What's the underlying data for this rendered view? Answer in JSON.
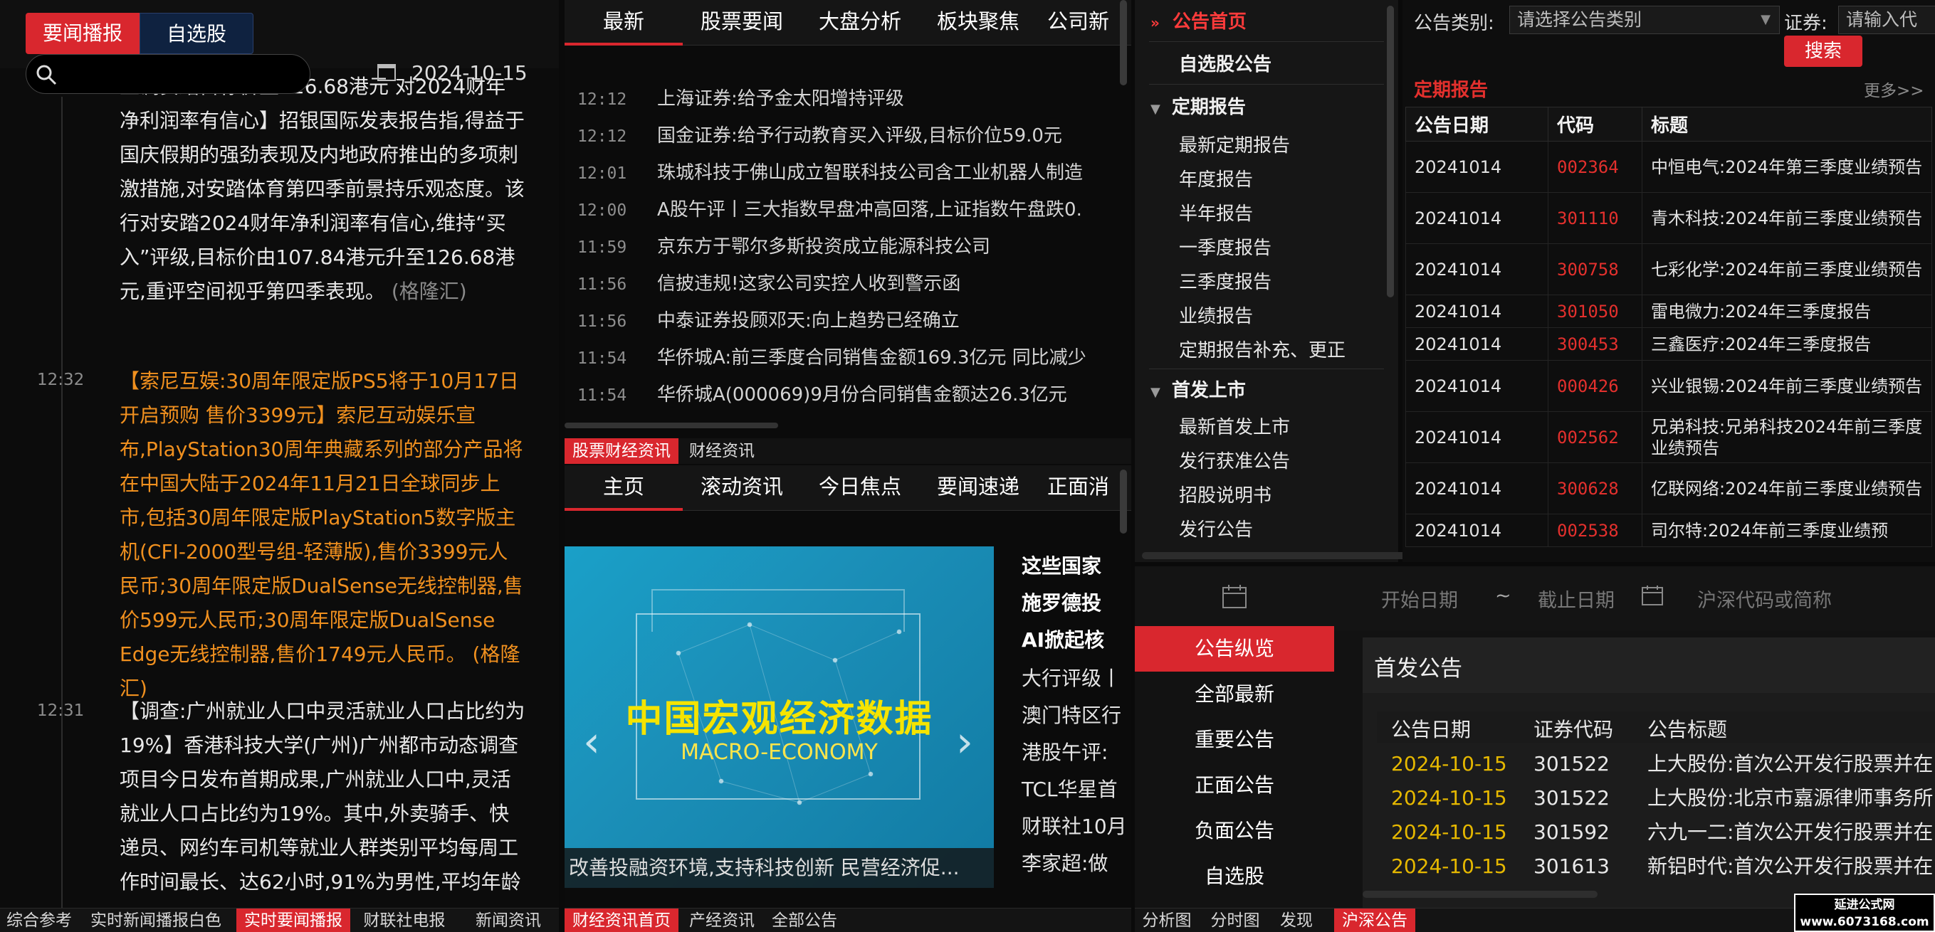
{
  "left": {
    "tabs": [
      "要闻播报",
      "自选股"
    ],
    "date": "2024-10-15",
    "items": [
      {
        "time": "",
        "highlight": false,
        "text": "上调安踏目标价至126.68港元 对2024财年净利润率有信心】招银国际发表报告指,得益于国庆假期的强劲表现及内地政府推出的多项刺激措施,对安踏体育第四季前景持乐观态度。该行对安踏2024财年净利润率有信心,维持“买入”评级,目标价由107.84港元升至126.68港元,重评空间视乎第四季表现。",
        "source": "(格隆汇)"
      },
      {
        "time": "12:32",
        "highlight": true,
        "text": "【索尼互娱:30周年限定版PS5将于10月17日开启预购 售价3399元】索尼互动娱乐宣布,PlayStation30周年典藏系列的部分产品将在中国大陆于2024年11月21日全球同步上市,包括30周年限定版PlayStation5数字版主机(CFI-2000型号组-轻薄版),售价3399元人民币;30周年限定版DualSense无线控制器,售价599元人民币;30周年限定版DualSense Edge无线控制器,售价1749元人民币。",
        "source": "(格隆汇)"
      },
      {
        "time": "12:31",
        "highlight": false,
        "text": "【调查:广州就业人口中灵活就业人口占比约为19%】香港科技大学(广州)广州都市动态调查项目今日发布首期成果,广州就业人口中,灵活就业人口占比约为19%。其中,外卖骑手、快递员、网约车司机等就业人群类别平均每周工作时间最长、达62小时,91%为男性,平均年龄",
        "source": ""
      }
    ],
    "bottom_tabs": [
      "综合参考",
      "实时新闻播报白色",
      "实时要闻播报",
      "财联社电报",
      "新闻资讯"
    ]
  },
  "mid": {
    "top_nav": [
      "最新",
      "股票要闻",
      "大盘分析",
      "板块聚焦",
      "公司新"
    ],
    "flash": [
      {
        "time": "12:12",
        "text": "上海证券:给予金太阳增持评级"
      },
      {
        "time": "12:12",
        "text": "国金证券:给予行动教育买入评级,目标价位59.0元"
      },
      {
        "time": "12:01",
        "text": "珠城科技于佛山成立智联科技公司含工业机器人制造"
      },
      {
        "time": "12:00",
        "text": "A股午评丨三大指数早盘冲高回落,上证指数午盘跌0."
      },
      {
        "time": "11:59",
        "text": "京东方于鄂尔多斯投资成立能源科技公司"
      },
      {
        "time": "11:56",
        "text": "信披违规!这家公司实控人收到警示函"
      },
      {
        "time": "11:56",
        "text": "中泰证券投顾邓天:向上趋势已经确立"
      },
      {
        "time": "11:54",
        "text": "华侨城A:前三季度合同销售金额169.3亿元 同比减少"
      },
      {
        "time": "11:54",
        "text": "华侨城A(000069)9月份合同销售金额达26.3亿元"
      }
    ],
    "sub_tabs": [
      "股票财经资讯",
      "财经资讯"
    ],
    "nav2": [
      "主页",
      "滚动资讯",
      "今日焦点",
      "要闻速递",
      "正面消"
    ],
    "banner": {
      "title": "中国宏观经济数据",
      "subtitle": "MACRO-ECONOMY",
      "caption": "改善投融资环境,支持科技创新 民营经济促..."
    },
    "side_list_bold": [
      "这些国家",
      "施罗德投",
      "AI掀起核"
    ],
    "side_list": [
      "大行评级丨",
      "澳门特区行",
      "港股午评:",
      "TCL华星首",
      "财联社10月",
      "李家超:做"
    ],
    "bottom_tabs": [
      "财经资讯首页",
      "产经资讯",
      "全部公告"
    ]
  },
  "menu": {
    "items": [
      {
        "label": "公告首页",
        "kind": "selected"
      },
      {
        "label": "自选股公告",
        "kind": "bold"
      },
      {
        "label": "定期报告",
        "kind": "group"
      },
      {
        "label": "最新定期报告",
        "kind": "item"
      },
      {
        "label": "年度报告",
        "kind": "item"
      },
      {
        "label": "半年报告",
        "kind": "item"
      },
      {
        "label": "一季度报告",
        "kind": "item"
      },
      {
        "label": "三季度报告",
        "kind": "item"
      },
      {
        "label": "业绩报告",
        "kind": "item"
      },
      {
        "label": "定期报告补充、更正",
        "kind": "item"
      },
      {
        "label": "首发上市",
        "kind": "group"
      },
      {
        "label": "最新首发上市",
        "kind": "item"
      },
      {
        "label": "发行获准公告",
        "kind": "item"
      },
      {
        "label": "招股说明书",
        "kind": "item"
      },
      {
        "label": "发行公告",
        "kind": "item"
      }
    ]
  },
  "right_top": {
    "category_label": "公告类别:",
    "category_placeholder": "请选择公告类别",
    "security_label": "证券:",
    "security_placeholder": "请输入代",
    "search": "搜索",
    "section_title": "定期报告",
    "more": "更多>>",
    "columns": [
      "公告日期",
      "代码",
      "标题"
    ],
    "rows": [
      {
        "date": "20241014",
        "code": "002364",
        "title": "中恒电气:2024年第三季度业绩预告"
      },
      {
        "date": "20241014",
        "code": "301110",
        "title": "青木科技:2024年前三季度业绩预告"
      },
      {
        "date": "20241014",
        "code": "300758",
        "title": "七彩化学:2024年前三季度业绩预告"
      },
      {
        "date": "20241014",
        "code": "301050",
        "title": "雷电微力:2024年三季度报告"
      },
      {
        "date": "20241014",
        "code": "300453",
        "title": "三鑫医疗:2024年三季度报告"
      },
      {
        "date": "20241014",
        "code": "000426",
        "title": "兴业银锡:2024年前三季度业绩预告"
      },
      {
        "date": "20241014",
        "code": "002562",
        "title": "兄弟科技:兄弟科技2024年前三季度业绩预告"
      },
      {
        "date": "20241014",
        "code": "300628",
        "title": "亿联网络:2024年前三季度业绩预告"
      },
      {
        "date": "20241014",
        "code": "002538",
        "title": "司尔特:2024年前三季度业绩预"
      }
    ]
  },
  "bottom_right": {
    "start_date": "开始日期",
    "tilde": "~",
    "end_date": "截止日期",
    "code_placeholder": "沪深代码或简称",
    "left_nav": [
      "公告纵览",
      "全部最新",
      "重要公告",
      "正面公告",
      "负面公告",
      "自选股"
    ],
    "panel_title": "首发公告",
    "columns": [
      "公告日期",
      "证券代码",
      "公告标题"
    ],
    "rows": [
      {
        "date": "2024-10-15",
        "code": "301522",
        "title": "上大股份:首次公开发行股票并在"
      },
      {
        "date": "2024-10-15",
        "code": "301522",
        "title": "上大股份:北京市嘉源律师事务所"
      },
      {
        "date": "2024-10-15",
        "code": "301592",
        "title": "六九一二:首次公开发行股票并在"
      },
      {
        "date": "2024-10-15",
        "code": "301613",
        "title": "新铝时代:首次公开发行股票并在"
      }
    ],
    "bottom_tabs": [
      "分析图",
      "分时图",
      "发现",
      "沪深公告"
    ],
    "watermark_line1": "延进公式网",
    "watermark_line2": "www.6073168.com"
  },
  "colors": {
    "accent": "#d9272e",
    "highlight_text": "#f0901f",
    "code_red": "#e3302d",
    "date_gold": "#e6b800"
  }
}
